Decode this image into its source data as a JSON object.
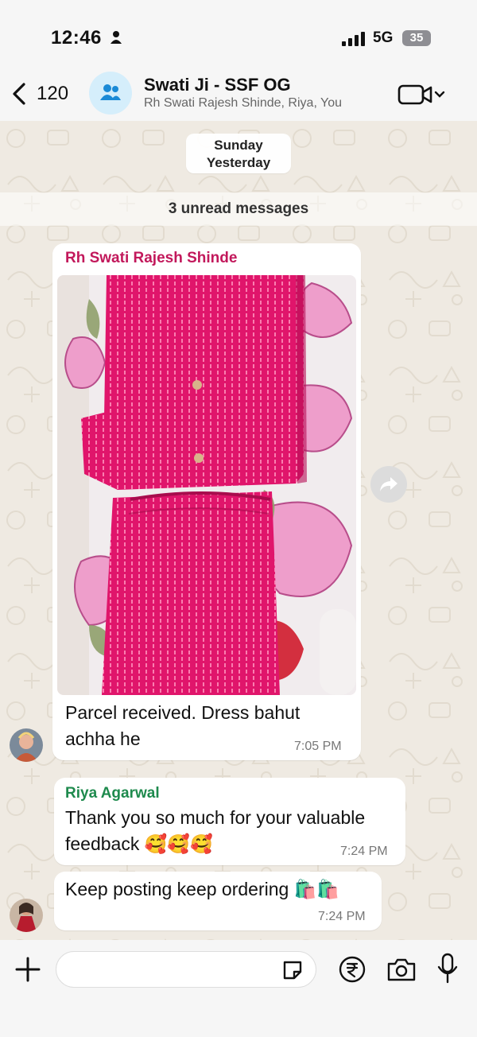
{
  "status_bar": {
    "time": "12:46",
    "network": "5G",
    "battery": "35"
  },
  "header": {
    "back_count": "120",
    "title": "Swati Ji - SSF OG",
    "subtitle": "Rh Swati Rajesh Shinde, Riya, You"
  },
  "date_pill": {
    "line1": "Sunday",
    "line2": "Yesterday"
  },
  "unread": "3 unread messages",
  "messages": [
    {
      "sender": "Rh Swati Rajesh Shinde",
      "sender_color": "#c2185b",
      "text_line1": "Parcel received. Dress bahut",
      "text_line2": "achha he",
      "time": "7:05 PM",
      "has_image": true
    },
    {
      "sender": "Riya Agarwal",
      "sender_color": "#1e8a4d",
      "text_line1": "Thank you so much for your valuable",
      "text_line2": "feedback",
      "emojis": "🥰🥰🥰",
      "time": "7:24 PM"
    },
    {
      "text_line1": "Keep posting keep ordering",
      "emojis": "🛍️🛍️",
      "time": "7:24 PM"
    }
  ],
  "composer": {
    "placeholder": ""
  }
}
